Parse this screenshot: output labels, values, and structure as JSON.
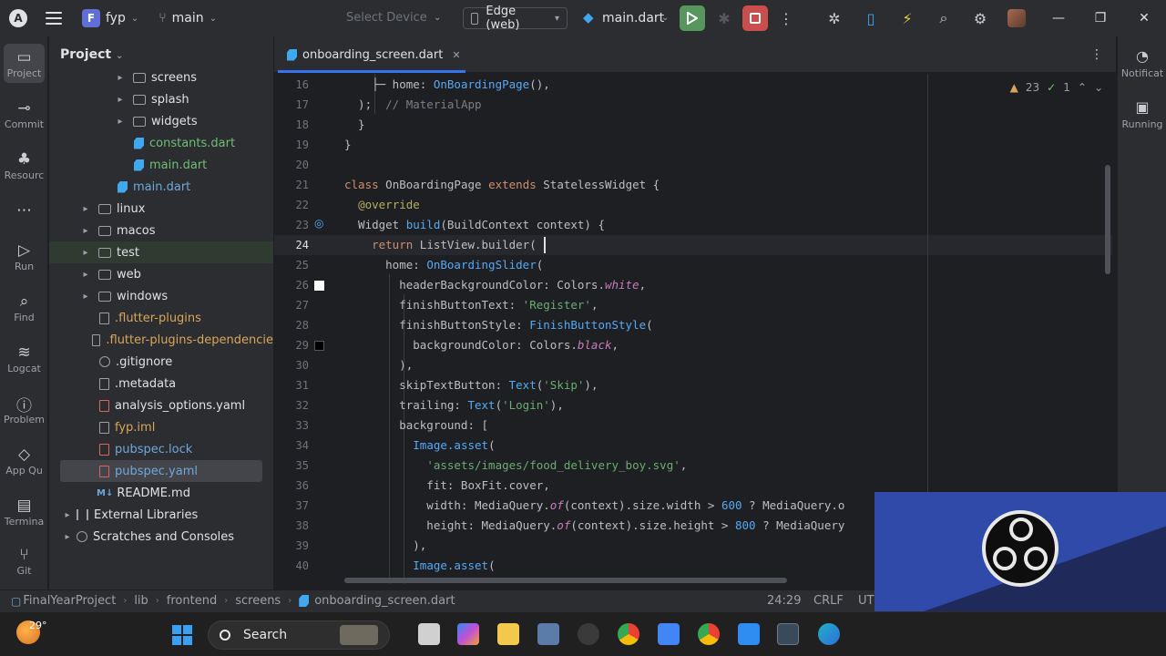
{
  "titlebar": {
    "app_logo": "A",
    "project_badge": "F",
    "project_name": "fyp",
    "branch": "main",
    "select_device": "Select Device",
    "device": "Edge (web)",
    "run_config": "main.dart"
  },
  "left_strip": [
    {
      "label": "Project",
      "icon": "folder-icon"
    },
    {
      "label": "Commit",
      "icon": "commit-icon"
    },
    {
      "label": "Resourc",
      "icon": "resource-icon"
    },
    {
      "label": "",
      "icon": "more-icon"
    },
    {
      "label": "Run",
      "icon": "run-icon"
    },
    {
      "label": "Find",
      "icon": "search-icon"
    },
    {
      "label": "Logcat",
      "icon": "logcat-icon"
    },
    {
      "label": "Problem",
      "icon": "problems-icon"
    },
    {
      "label": "App Qu",
      "icon": "app-quality-icon"
    },
    {
      "label": "Termina",
      "icon": "terminal-icon"
    },
    {
      "label": "Git",
      "icon": "git-icon"
    }
  ],
  "project_panel": {
    "title": "Project",
    "items": [
      {
        "label": "screens",
        "type": "folder",
        "indent": 2,
        "arrow": "▸",
        "color": "normal"
      },
      {
        "label": "splash",
        "type": "folder",
        "indent": 2,
        "arrow": "▸",
        "color": "normal"
      },
      {
        "label": "widgets",
        "type": "folder",
        "indent": 2,
        "arrow": "▸",
        "color": "normal"
      },
      {
        "label": "constants.dart",
        "type": "dart",
        "indent": 2,
        "arrow": "",
        "color": "green"
      },
      {
        "label": "main.dart",
        "type": "dart",
        "indent": 2,
        "arrow": "",
        "color": "green"
      },
      {
        "label": "main.dart",
        "type": "dart",
        "indent": 1,
        "arrow": "",
        "color": "blue"
      },
      {
        "label": "linux",
        "type": "folder",
        "indent": 0,
        "arrow": "▸",
        "color": "normal"
      },
      {
        "label": "macos",
        "type": "folder",
        "indent": 0,
        "arrow": "▸",
        "color": "normal"
      },
      {
        "label": "test",
        "type": "folder",
        "indent": 0,
        "arrow": "▸",
        "color": "normal"
      },
      {
        "label": "web",
        "type": "folder",
        "indent": 0,
        "arrow": "▸",
        "color": "normal"
      },
      {
        "label": "windows",
        "type": "folder",
        "indent": 0,
        "arrow": "▸",
        "color": "normal"
      },
      {
        "label": ".flutter-plugins",
        "type": "file",
        "indent": 0,
        "arrow": "",
        "color": "orange"
      },
      {
        "label": ".flutter-plugins-dependencie",
        "type": "file",
        "indent": 0,
        "arrow": "",
        "color": "orange"
      },
      {
        "label": ".gitignore",
        "type": "dot",
        "indent": 0,
        "arrow": "",
        "color": "normal"
      },
      {
        "label": ".metadata",
        "type": "file",
        "indent": 0,
        "arrow": "",
        "color": "normal"
      },
      {
        "label": "analysis_options.yaml",
        "type": "filered",
        "indent": 0,
        "arrow": "",
        "color": "normal"
      },
      {
        "label": "fyp.iml",
        "type": "file",
        "indent": 0,
        "arrow": "",
        "color": "orange"
      },
      {
        "label": "pubspec.lock",
        "type": "filered",
        "indent": 0,
        "arrow": "",
        "color": "blue"
      },
      {
        "label": "pubspec.yaml",
        "type": "filered",
        "indent": 0,
        "arrow": "",
        "color": "blue"
      },
      {
        "label": "README.md",
        "type": "md",
        "indent": 0,
        "arrow": "",
        "color": "normal"
      },
      {
        "label": "External Libraries",
        "type": "lib",
        "indent": -1,
        "arrow": "▸",
        "color": "normal"
      },
      {
        "label": "Scratches and Consoles",
        "type": "scratch",
        "indent": -1,
        "arrow": "▸",
        "color": "normal"
      }
    ]
  },
  "editor": {
    "tab_label": "onboarding_screen.dart",
    "warnings": "23",
    "weak_warnings": "1",
    "lines": [
      {
        "n": "16",
        "html": "    ├─ home: <span class='fn'>OnBoardingPage</span>(),"
      },
      {
        "n": "17",
        "html": "  );  <span class='cmt'>// MaterialApp</span>"
      },
      {
        "n": "18",
        "html": "  }"
      },
      {
        "n": "19",
        "html": "}"
      },
      {
        "n": "20",
        "html": ""
      },
      {
        "n": "21",
        "html": "<span class='kw'>class</span> OnBoardingPage <span class='kw'>extends</span> StatelessWidget {"
      },
      {
        "n": "22",
        "html": "  <span class='ann'>@override</span>"
      },
      {
        "n": "23",
        "html": "  Widget <span class='fn'>build</span>(BuildContext context) {"
      },
      {
        "n": "24",
        "html": "    <span class='kw'>return</span> ListView.builder("
      },
      {
        "n": "25",
        "html": "      home: <span class='fn'>OnBoardingSlider</span>("
      },
      {
        "n": "26",
        "html": "        headerBackgroundColor: Colors.<span class='ital'>white</span>,"
      },
      {
        "n": "27",
        "html": "        finishButtonText: <span class='str'>'Register'</span>,"
      },
      {
        "n": "28",
        "html": "        finishButtonStyle: <span class='fn'>FinishButtonStyle</span>("
      },
      {
        "n": "29",
        "html": "          backgroundColor: Colors.<span class='ital'>black</span>,"
      },
      {
        "n": "30",
        "html": "        ),"
      },
      {
        "n": "31",
        "html": "        skipTextButton: <span class='fn'>Text</span>(<span class='str'>'Skip'</span>),"
      },
      {
        "n": "32",
        "html": "        trailing: <span class='fn'>Text</span>(<span class='str'>'Login'</span>),"
      },
      {
        "n": "33",
        "html": "        background: ["
      },
      {
        "n": "34",
        "html": "          <span class='fn'>Image.asset</span>("
      },
      {
        "n": "35",
        "html": "            <span class='str'>'assets/images/food_delivery_boy.svg'</span>,"
      },
      {
        "n": "36",
        "html": "            fit: BoxFit.cover,"
      },
      {
        "n": "37",
        "html": "            width: MediaQuery.<span class='ital'>of</span>(context).size.width &gt; <span class='fn'>600</span> ? MediaQuery.o"
      },
      {
        "n": "38",
        "html": "            height: MediaQuery.<span class='ital'>of</span>(context).size.height &gt; <span class='fn'>800</span> ? MediaQuery"
      },
      {
        "n": "39",
        "html": "          ),"
      },
      {
        "n": "40",
        "html": "          <span class='fn'>Image.asset</span>("
      }
    ]
  },
  "right_strip": [
    {
      "label": "Notificat",
      "icon": "bell-icon"
    },
    {
      "label": "Running",
      "icon": "running-devices-icon"
    }
  ],
  "statusbar": {
    "crumbs": [
      "FinalYearProject",
      "lib",
      "frontend",
      "screens",
      "onboarding_screen.dart"
    ],
    "position": "24:29",
    "line_sep": "CRLF",
    "encoding": "UT"
  },
  "taskbar": {
    "temperature": "29°",
    "search_label": "Search"
  }
}
